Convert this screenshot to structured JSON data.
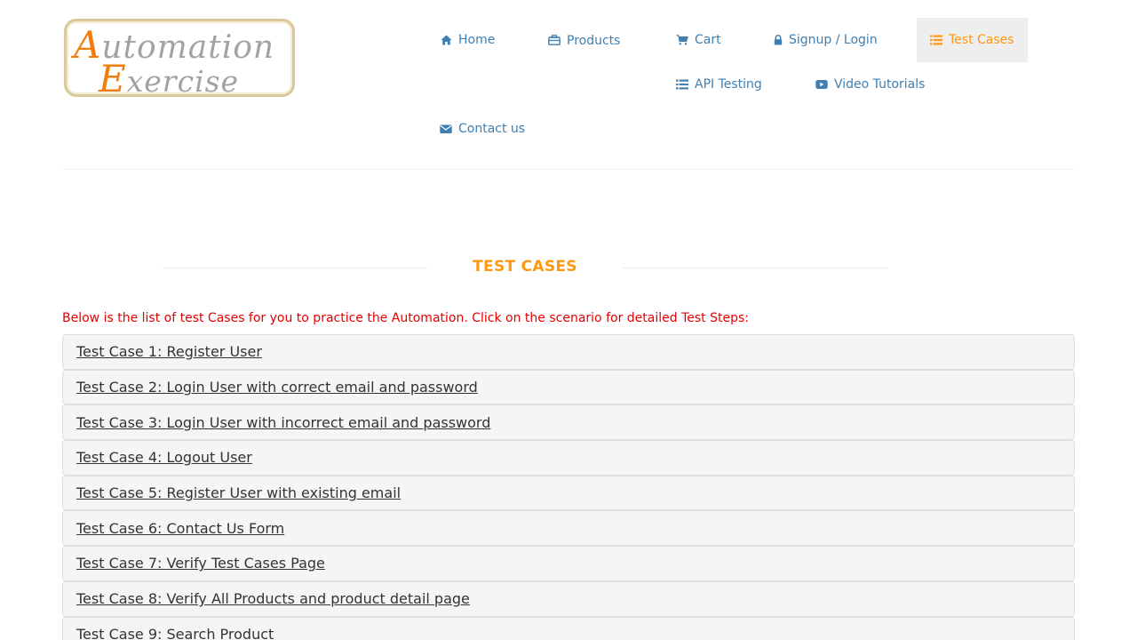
{
  "logo": {
    "line1_cap": "A",
    "line1_rest": "utomation",
    "line2_cap": "E",
    "line2_rest": "xercise"
  },
  "nav": {
    "home": "Home",
    "products": "Products",
    "cart": "Cart",
    "signup_login": "Signup / Login",
    "test_cases": "Test Cases",
    "api_testing": "API Testing",
    "video_tutorials": "Video Tutorials",
    "contact_us": "Contact us"
  },
  "page": {
    "title": "TEST CASES",
    "intro": "Below is the list of test Cases for you to practice the Automation. Click on the scenario for detailed Test Steps:"
  },
  "test_cases": [
    "Test Case 1: Register User",
    "Test Case 2: Login User with correct email and password",
    "Test Case 3: Login User with incorrect email and password",
    "Test Case 4: Logout User",
    "Test Case 5: Register User with existing email",
    "Test Case 6: Contact Us Form",
    "Test Case 7: Verify Test Cases Page",
    "Test Case 8: Verify All Products and product detail page",
    "Test Case 9: Search Product"
  ],
  "colors": {
    "accent": "#fe980f",
    "link": "#3f7fb1",
    "intro_red": "#e60000"
  },
  "icons": {
    "home": "home-icon",
    "products": "briefcase-icon",
    "cart": "cart-icon",
    "signup_login": "lock-icon",
    "test_cases": "list-icon",
    "api_testing": "list-icon",
    "video_tutorials": "youtube-play-icon",
    "contact_us": "envelope-icon"
  }
}
